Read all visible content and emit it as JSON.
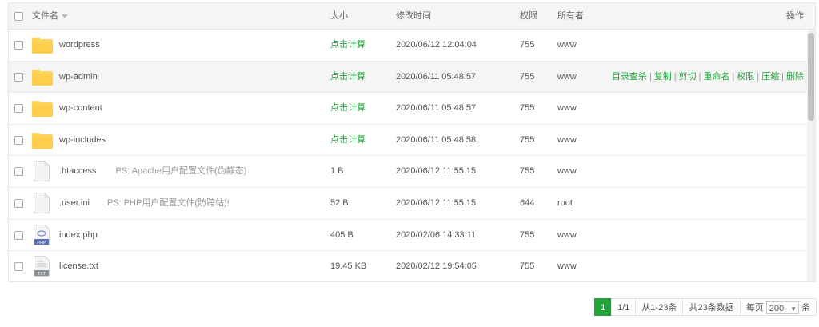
{
  "header": {
    "name": "文件名",
    "size": "大小",
    "mtime": "修改时间",
    "perm": "权限",
    "owner": "所有者",
    "ops": "操作"
  },
  "rows": [
    {
      "name": "wordpress",
      "size": "点击计算",
      "mtime": "2020/06/12 12:04:04",
      "perm": "755",
      "owner": "www"
    },
    {
      "name": "wp-admin",
      "size": "点击计算",
      "mtime": "2020/06/11 05:48:57",
      "perm": "755",
      "owner": "www"
    },
    {
      "name": "wp-content",
      "size": "点击计算",
      "mtime": "2020/06/11 05:48:57",
      "perm": "755",
      "owner": "www"
    },
    {
      "name": "wp-includes",
      "size": "点击计算",
      "mtime": "2020/06/11 05:48:58",
      "perm": "755",
      "owner": "www"
    },
    {
      "name": ".htaccess",
      "ps": "PS: Apache用户配置文件(伪静态)",
      "size": "1 B",
      "mtime": "2020/06/12 11:55:15",
      "perm": "755",
      "owner": "www"
    },
    {
      "name": ".user.ini",
      "ps": "PS: PHP用户配置文件(防跨站)!",
      "size": "52 B",
      "mtime": "2020/06/12 11:55:15",
      "perm": "644",
      "owner": "root"
    },
    {
      "name": "index.php",
      "size": "405 B",
      "mtime": "2020/02/06 14:33:11",
      "perm": "755",
      "owner": "www",
      "badge": "PHP"
    },
    {
      "name": "license.txt",
      "size": "19.45 KB",
      "mtime": "2020/02/12 19:54:05",
      "perm": "755",
      "owner": "www",
      "badge": "TXT"
    }
  ],
  "row_actions": [
    "目录查杀",
    "复制",
    "剪切",
    "重命名",
    "权限",
    "压缩",
    "删除"
  ],
  "pagination": {
    "current": "1",
    "pages": "1/1",
    "range": "从1-23条",
    "total": "共23条数据",
    "per_page_prefix": "每页",
    "per_page_value": "200",
    "per_page_suffix": "条"
  },
  "colors": {
    "accent": "#20a53a",
    "folder": "#ffd65c"
  }
}
